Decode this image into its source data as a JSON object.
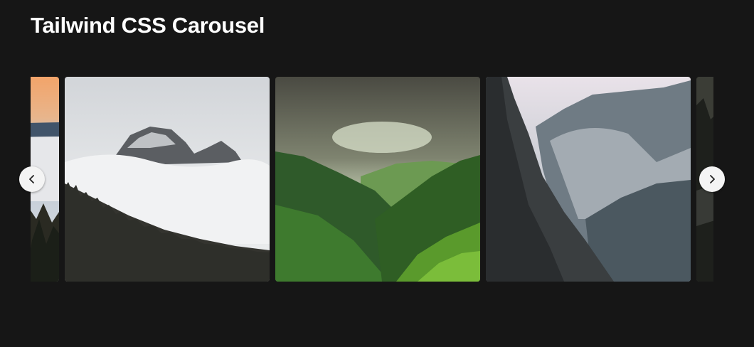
{
  "header": {
    "title": "Tailwind CSS Carousel"
  },
  "carousel": {
    "slides": [
      {
        "name": "sunset-mist-forest-slide"
      },
      {
        "name": "snowy-peak-clouds-slide"
      },
      {
        "name": "green-valley-slide"
      },
      {
        "name": "misty-cliffs-slide"
      },
      {
        "name": "dark-forest-slide"
      }
    ],
    "prev_icon": "chevron-left-icon",
    "next_icon": "chevron-right-icon"
  },
  "colors": {
    "background": "#161616",
    "title": "#ffffff",
    "nav_button": "#f4f4f4",
    "nav_icon": "#222222"
  }
}
